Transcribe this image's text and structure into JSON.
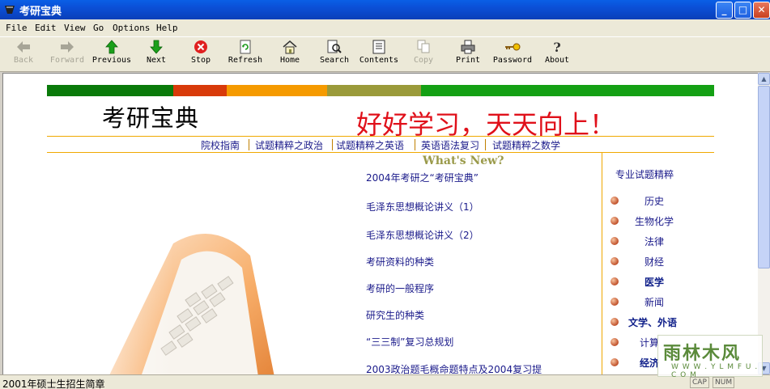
{
  "window": {
    "title": "考研宝典"
  },
  "menu": [
    "File",
    "Edit",
    "View",
    "Go",
    "Options",
    "Help"
  ],
  "toolbar": {
    "back": "Back",
    "forward": "Forward",
    "previous": "Previous",
    "next": "Next",
    "stop": "Stop",
    "refresh": "Refresh",
    "home": "Home",
    "search": "Search",
    "contents": "Contents",
    "copy": "Copy",
    "print": "Print",
    "password": "Password",
    "about": "About"
  },
  "page": {
    "site_title": "考研宝典",
    "slogan": "好好学习，天天向上！",
    "nav": [
      "院校指南",
      "试题精粹之政治",
      "试题精粹之英语",
      "英语语法复习",
      "试题精粹之数学"
    ],
    "whats_new_heading": "What's New?",
    "news": [
      "2004年考研之“考研宝典”",
      "毛泽东思想概论讲义（1）",
      "毛泽东思想概论讲义（2）",
      "考研资料的种类",
      "考研的一般程序",
      "研究生的种类",
      "“三三制”复习总规划",
      "2003政治题毛概命题特点及2004复习提"
    ],
    "category_title": "专业试题精粹",
    "categories": [
      "历史",
      "生物化学",
      "法律",
      "财经",
      "医学",
      "新闻",
      "文学、外语",
      "计算",
      "经济"
    ]
  },
  "statusbar": {
    "text": "2001年硕士生招生简章",
    "pane1": "CAP",
    "pane2": "NUM"
  },
  "watermark": {
    "main": "雨林木风",
    "sub": "W W W . Y L M F U . C O M"
  },
  "colors": {
    "bar_green_dark": "#0a7a0a",
    "bar_red": "#d83a0a",
    "bar_orange": "#f59a00",
    "bar_olive": "#9a9a3a",
    "bar_green": "#14a014",
    "slogan": "#e0101a",
    "accent_line": "#f0a800"
  }
}
